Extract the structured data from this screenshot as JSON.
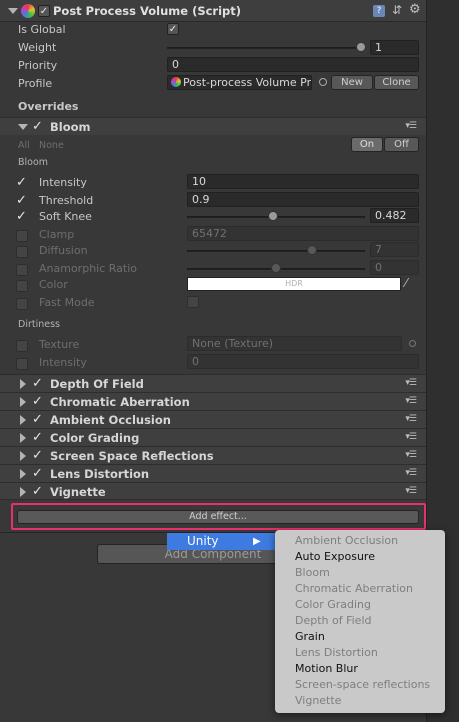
{
  "component": {
    "title": "Post Process Volume (Script)",
    "is_global_label": "Is Global",
    "is_global_checked": true,
    "weight_label": "Weight",
    "weight_value": "1",
    "priority_label": "Priority",
    "priority_value": "0",
    "profile_label": "Profile",
    "profile_value": "Post-process Volume Pr",
    "new_label": "New",
    "clone_label": "Clone"
  },
  "overrides": {
    "heading": "Overrides",
    "bloom": {
      "title": "Bloom",
      "all_label": "All",
      "none_label": "None",
      "on_label": "On",
      "off_label": "Off",
      "group_label": "Bloom",
      "intensity_label": "Intensity",
      "intensity_value": "10",
      "threshold_label": "Threshold",
      "threshold_value": "0.9",
      "soft_knee_label": "Soft Knee",
      "soft_knee_value": "0.482",
      "soft_knee_fraction": 0.482,
      "clamp_label": "Clamp",
      "clamp_value": "65472",
      "diffusion_label": "Diffusion",
      "diffusion_value": "7",
      "diffusion_fraction": 0.7,
      "anamorphic_label": "Anamorphic Ratio",
      "anamorphic_value": "0",
      "anamorphic_fraction": 0.5,
      "color_label": "Color",
      "color_value": "HDR",
      "fast_mode_label": "Fast Mode",
      "dirtiness_label": "Dirtiness",
      "texture_label": "Texture",
      "texture_value": "None (Texture)",
      "dirt_intensity_label": "Intensity",
      "dirt_intensity_value": "0"
    },
    "effects": [
      {
        "title": "Depth Of Field"
      },
      {
        "title": "Chromatic Aberration"
      },
      {
        "title": "Ambient Occlusion"
      },
      {
        "title": "Color Grading"
      },
      {
        "title": "Screen Space Reflections"
      },
      {
        "title": "Lens Distortion"
      },
      {
        "title": "Vignette"
      }
    ],
    "add_effect_label": "Add effect..."
  },
  "add_component_label": "Add Component",
  "menu": {
    "category": "Unity",
    "items": [
      {
        "label": "Ambient Occlusion",
        "enabled": false
      },
      {
        "label": "Auto Exposure",
        "enabled": true
      },
      {
        "label": "Bloom",
        "enabled": false
      },
      {
        "label": "Chromatic Aberration",
        "enabled": false
      },
      {
        "label": "Color Grading",
        "enabled": false
      },
      {
        "label": "Depth of Field",
        "enabled": false
      },
      {
        "label": "Grain",
        "enabled": true
      },
      {
        "label": "Lens Distortion",
        "enabled": false
      },
      {
        "label": "Motion Blur",
        "enabled": true
      },
      {
        "label": "Screen-space reflections",
        "enabled": false
      },
      {
        "label": "Vignette",
        "enabled": false
      }
    ]
  },
  "colors": {
    "accent_highlight": "#e8306a",
    "menu_selection": "#3d7be0"
  }
}
